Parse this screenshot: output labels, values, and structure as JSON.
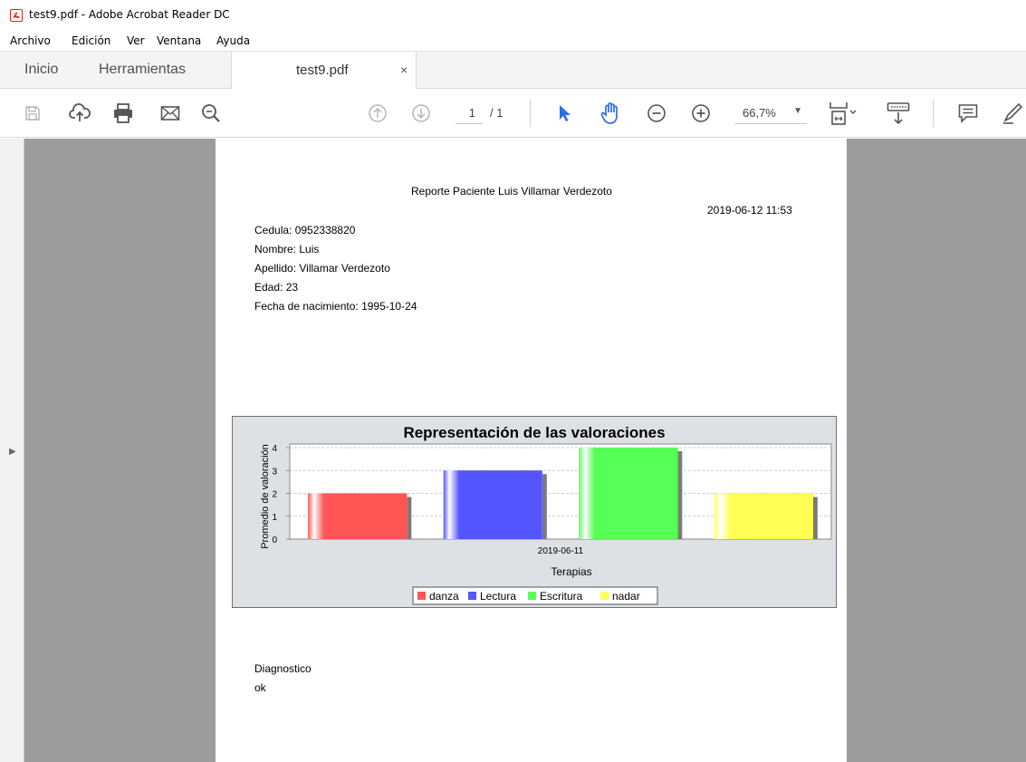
{
  "window": {
    "title": "test9.pdf - Adobe Acrobat Reader DC"
  },
  "menubar": {
    "items": [
      "Archivo",
      "Edición",
      "Ver",
      "Ventana",
      "Ayuda"
    ]
  },
  "tabs": {
    "home": "Inicio",
    "tools": "Herramientas",
    "document": "test9.pdf",
    "close": "×"
  },
  "toolbar": {
    "page_current": "1",
    "page_total": "/ 1",
    "zoom": "66,7%",
    "zoom_caret": "▼",
    "icons": [
      "save-icon",
      "upload-cloud-icon",
      "print-icon",
      "email-icon",
      "zoom-search-icon",
      "page-up-icon",
      "page-down-icon",
      "select-arrow-icon",
      "hand-tool-icon",
      "zoom-out-icon",
      "zoom-in-icon",
      "fit-page-icon",
      "scroll-mode-icon",
      "comment-icon",
      "highlight-pen-icon"
    ]
  },
  "colors": {
    "accent_blue": "#2d6ee0",
    "acrobat_red": "#d9261c",
    "chart_bg": "#dde1e6",
    "series_danza": "#ff5555",
    "series_lectura": "#5555ff",
    "series_escritura": "#55ff55",
    "series_nadar": "#ffff55"
  },
  "document": {
    "report_title": "Reporte Paciente Luis  Villamar Verdezoto",
    "report_date": "2019-06-12 11:53",
    "info_lines": [
      "Cedula: 0952338820",
      "Nombre: Luis",
      "Apellido: Villamar Verdezoto",
      "Edad: 23",
      "Fecha de nacimiento: 1995-10-24"
    ],
    "diagnosis_label": "Diagnostico",
    "diagnosis_value": "ok"
  },
  "chart_data": {
    "type": "bar",
    "title": "Representación de las valoraciones",
    "xlabel": "Terapias",
    "ylabel": "Promedio de valoración",
    "categories": [
      "2019-06-11"
    ],
    "series": [
      {
        "name": "danza",
        "values": [
          2
        ],
        "color": "#ff5555"
      },
      {
        "name": "Lectura",
        "values": [
          3
        ],
        "color": "#5555ff"
      },
      {
        "name": "Escritura",
        "values": [
          4
        ],
        "color": "#55ff55"
      },
      {
        "name": "nadar",
        "values": [
          2
        ],
        "color": "#ffff55"
      }
    ],
    "ylim": [
      0,
      4
    ],
    "yticks": [
      0,
      1,
      2,
      3,
      4
    ],
    "grid": true,
    "legend": "bottom"
  }
}
